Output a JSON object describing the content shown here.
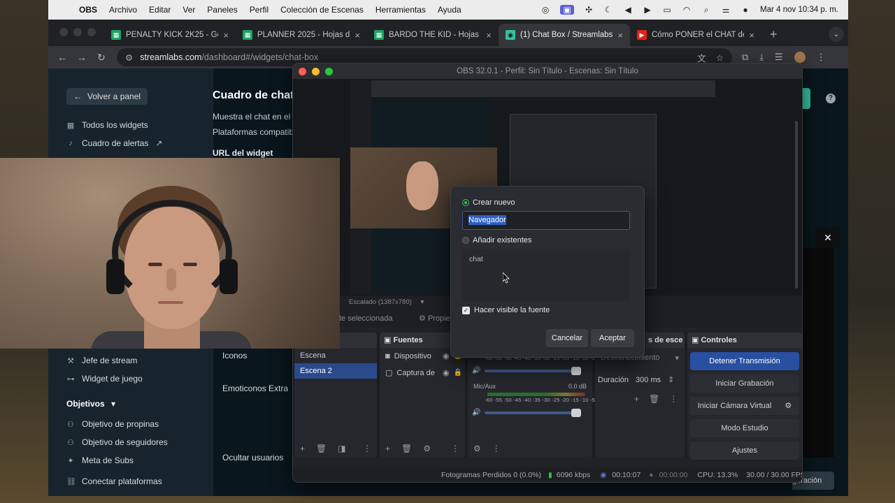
{
  "menubar": {
    "app": "OBS",
    "items": [
      "Archivo",
      "Editar",
      "Ver",
      "Paneles",
      "Perfil",
      "Colección de Escenas",
      "Herramientas",
      "Ayuda"
    ],
    "clock": "Mar 4 nov  10:34 p. m."
  },
  "browser": {
    "tabs": [
      {
        "title": "PENALTY KICK 2K25 - Google",
        "icon": "sheets-icon"
      },
      {
        "title": "PLANNER 2025 - Hojas de cá",
        "icon": "sheets-icon"
      },
      {
        "title": "BARDO THE KID - Hojas de c",
        "icon": "sheets-icon"
      },
      {
        "title": "(1) Chat Box / Streamlabs",
        "icon": "streamlabs-icon"
      },
      {
        "title": "Cómo PONER el CHAT de KIC",
        "icon": "youtube-icon"
      }
    ],
    "url_host": "streamlabs.com",
    "url_path": "/dashboard#/widgets/chat-box"
  },
  "streamlabs": {
    "back_label": "Volver a panel",
    "nav_top": [
      {
        "label": "Todos los widgets",
        "icon": "grid-icon"
      },
      {
        "label": "Cuadro de alertas",
        "icon": "bell-icon"
      }
    ],
    "nav_mid": [
      {
        "label": "Jefe de stream",
        "icon": "hammer-icon"
      },
      {
        "label": "Widget de juego",
        "icon": "gamepad-icon"
      }
    ],
    "group_label": "Objetivos",
    "nav_goals": [
      {
        "label": "Objetivo de propinas",
        "icon": "people-icon"
      },
      {
        "label": "Objetivo de seguidores",
        "icon": "people-icon"
      },
      {
        "label": "Meta de Subs",
        "icon": "star-icon"
      }
    ],
    "connect_label": "Conectar plataformas",
    "title": "Cuadro de chat",
    "desc1": "Muestra el chat en el st",
    "desc2": "Plataformas compatibl",
    "url_label": "URL del widget",
    "row_icons": "Iconos",
    "row_emotes": "Emoticonos Extra",
    "row_hide": "Ocultar usuarios",
    "teal_btn": "as",
    "config_btn": "guración"
  },
  "obs": {
    "title": "OBS 32.0.1 - Perfil: Sin Título - Escenas: Sin Título",
    "scale_label": "Escalado (1387x780)",
    "no_source_label": "te seleccionada",
    "properties_label": "Propie",
    "docks": {
      "scenes": {
        "items": [
          "Escena",
          "Escena 2"
        ],
        "selected": 1
      },
      "sources": {
        "title": "Fuentes",
        "items": [
          "Dispositivo",
          "Captura de"
        ]
      },
      "mixer": {
        "channel": "Mic/Aux",
        "db": "0.0 dB",
        "ticks": "-60 -55 -50 -45 -40 -35 -30 -25 -20 -15 -10 -5 0"
      },
      "transitions": {
        "title": "s de esce",
        "mode": "Desvanecimiento",
        "duration_label": "Duración",
        "duration_value": "300 ms"
      },
      "controls": {
        "title": "Controles",
        "buttons": [
          "Detener Transmisión",
          "Iniciar Grabación",
          "Iniciar Cámara Virtual",
          "Modo Estudio",
          "Ajustes"
        ]
      }
    },
    "status": {
      "dropped": "Fotogramas Perdidos 0 (0.0%)",
      "bitrate": "6096 kbps",
      "stream_time": "00:10:07",
      "rec_time": "00:00:00",
      "cpu": "CPU: 13.3%",
      "fps": "30.00 / 30.00 FPS"
    }
  },
  "dialog": {
    "create_label": "Crear nuevo",
    "name_value": "Navegador",
    "add_existing_label": "Añadir existentes",
    "existing_items": [
      "chat"
    ],
    "visible_label": "Hacer visible la fuente",
    "cancel_label": "Cancelar",
    "accept_label": "Aceptar"
  },
  "colors": {
    "obs_primary": "#284fa0",
    "streamlabs_teal": "#31c3a2",
    "radio_on": "#2ec24e"
  }
}
